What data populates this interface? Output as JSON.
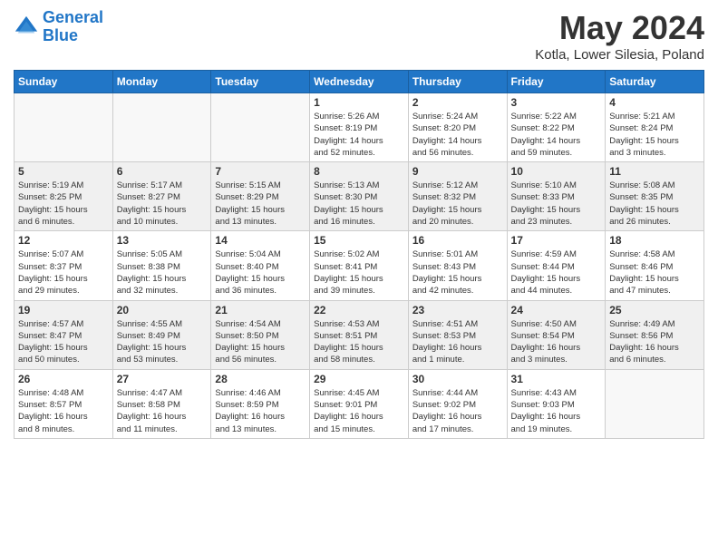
{
  "header": {
    "logo_line1": "General",
    "logo_line2": "Blue",
    "month": "May 2024",
    "location": "Kotla, Lower Silesia, Poland"
  },
  "weekdays": [
    "Sunday",
    "Monday",
    "Tuesday",
    "Wednesday",
    "Thursday",
    "Friday",
    "Saturday"
  ],
  "weeks": [
    [
      {
        "day": "",
        "info": ""
      },
      {
        "day": "",
        "info": ""
      },
      {
        "day": "",
        "info": ""
      },
      {
        "day": "1",
        "info": "Sunrise: 5:26 AM\nSunset: 8:19 PM\nDaylight: 14 hours\nand 52 minutes."
      },
      {
        "day": "2",
        "info": "Sunrise: 5:24 AM\nSunset: 8:20 PM\nDaylight: 14 hours\nand 56 minutes."
      },
      {
        "day": "3",
        "info": "Sunrise: 5:22 AM\nSunset: 8:22 PM\nDaylight: 14 hours\nand 59 minutes."
      },
      {
        "day": "4",
        "info": "Sunrise: 5:21 AM\nSunset: 8:24 PM\nDaylight: 15 hours\nand 3 minutes."
      }
    ],
    [
      {
        "day": "5",
        "info": "Sunrise: 5:19 AM\nSunset: 8:25 PM\nDaylight: 15 hours\nand 6 minutes."
      },
      {
        "day": "6",
        "info": "Sunrise: 5:17 AM\nSunset: 8:27 PM\nDaylight: 15 hours\nand 10 minutes."
      },
      {
        "day": "7",
        "info": "Sunrise: 5:15 AM\nSunset: 8:29 PM\nDaylight: 15 hours\nand 13 minutes."
      },
      {
        "day": "8",
        "info": "Sunrise: 5:13 AM\nSunset: 8:30 PM\nDaylight: 15 hours\nand 16 minutes."
      },
      {
        "day": "9",
        "info": "Sunrise: 5:12 AM\nSunset: 8:32 PM\nDaylight: 15 hours\nand 20 minutes."
      },
      {
        "day": "10",
        "info": "Sunrise: 5:10 AM\nSunset: 8:33 PM\nDaylight: 15 hours\nand 23 minutes."
      },
      {
        "day": "11",
        "info": "Sunrise: 5:08 AM\nSunset: 8:35 PM\nDaylight: 15 hours\nand 26 minutes."
      }
    ],
    [
      {
        "day": "12",
        "info": "Sunrise: 5:07 AM\nSunset: 8:37 PM\nDaylight: 15 hours\nand 29 minutes."
      },
      {
        "day": "13",
        "info": "Sunrise: 5:05 AM\nSunset: 8:38 PM\nDaylight: 15 hours\nand 32 minutes."
      },
      {
        "day": "14",
        "info": "Sunrise: 5:04 AM\nSunset: 8:40 PM\nDaylight: 15 hours\nand 36 minutes."
      },
      {
        "day": "15",
        "info": "Sunrise: 5:02 AM\nSunset: 8:41 PM\nDaylight: 15 hours\nand 39 minutes."
      },
      {
        "day": "16",
        "info": "Sunrise: 5:01 AM\nSunset: 8:43 PM\nDaylight: 15 hours\nand 42 minutes."
      },
      {
        "day": "17",
        "info": "Sunrise: 4:59 AM\nSunset: 8:44 PM\nDaylight: 15 hours\nand 44 minutes."
      },
      {
        "day": "18",
        "info": "Sunrise: 4:58 AM\nSunset: 8:46 PM\nDaylight: 15 hours\nand 47 minutes."
      }
    ],
    [
      {
        "day": "19",
        "info": "Sunrise: 4:57 AM\nSunset: 8:47 PM\nDaylight: 15 hours\nand 50 minutes."
      },
      {
        "day": "20",
        "info": "Sunrise: 4:55 AM\nSunset: 8:49 PM\nDaylight: 15 hours\nand 53 minutes."
      },
      {
        "day": "21",
        "info": "Sunrise: 4:54 AM\nSunset: 8:50 PM\nDaylight: 15 hours\nand 56 minutes."
      },
      {
        "day": "22",
        "info": "Sunrise: 4:53 AM\nSunset: 8:51 PM\nDaylight: 15 hours\nand 58 minutes."
      },
      {
        "day": "23",
        "info": "Sunrise: 4:51 AM\nSunset: 8:53 PM\nDaylight: 16 hours\nand 1 minute."
      },
      {
        "day": "24",
        "info": "Sunrise: 4:50 AM\nSunset: 8:54 PM\nDaylight: 16 hours\nand 3 minutes."
      },
      {
        "day": "25",
        "info": "Sunrise: 4:49 AM\nSunset: 8:56 PM\nDaylight: 16 hours\nand 6 minutes."
      }
    ],
    [
      {
        "day": "26",
        "info": "Sunrise: 4:48 AM\nSunset: 8:57 PM\nDaylight: 16 hours\nand 8 minutes."
      },
      {
        "day": "27",
        "info": "Sunrise: 4:47 AM\nSunset: 8:58 PM\nDaylight: 16 hours\nand 11 minutes."
      },
      {
        "day": "28",
        "info": "Sunrise: 4:46 AM\nSunset: 8:59 PM\nDaylight: 16 hours\nand 13 minutes."
      },
      {
        "day": "29",
        "info": "Sunrise: 4:45 AM\nSunset: 9:01 PM\nDaylight: 16 hours\nand 15 minutes."
      },
      {
        "day": "30",
        "info": "Sunrise: 4:44 AM\nSunset: 9:02 PM\nDaylight: 16 hours\nand 17 minutes."
      },
      {
        "day": "31",
        "info": "Sunrise: 4:43 AM\nSunset: 9:03 PM\nDaylight: 16 hours\nand 19 minutes."
      },
      {
        "day": "",
        "info": ""
      }
    ]
  ]
}
